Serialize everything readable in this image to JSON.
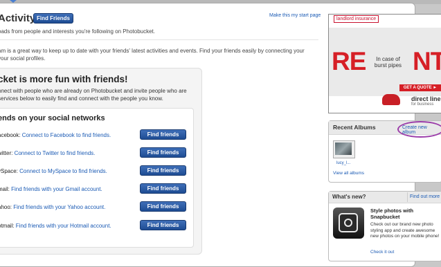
{
  "header": {
    "title": "Activity",
    "find_friends_label": "Find Friends",
    "make_start_page": "Make this my start page",
    "subtitle": "oads from people and interests you're following on Photobucket."
  },
  "intro": {
    "line1": "am is a great way to keep up to date with your friends' latest activities and events. Find your friends easily by connecting your",
    "line2": "your social profiles."
  },
  "panel": {
    "heading": "cket is more fun with friends!",
    "line1": "nnect with people who are already on Photobucket and invite people who are",
    "line2": "services below to easily find and connect with the people you know.",
    "networks_heading": "ends on your social networks",
    "rows": [
      {
        "name": "acebook:",
        "link": "Connect to Facebook to find friends.",
        "button": "Find friends"
      },
      {
        "name": "witter:",
        "link": "Connect to Twitter to find friends.",
        "button": "Find friends"
      },
      {
        "name": "ySpace:",
        "link": "Connect to MySpace to find friends.",
        "button": "Find friends"
      },
      {
        "name": "mail:",
        "link": "Find friends with your Gmail account.",
        "button": "Find friends"
      },
      {
        "name": "ahoo:",
        "link": "Find friends with your Yahoo account.",
        "button": "Find friends"
      },
      {
        "name": "otmail:",
        "link": "Find friends with your Hotmail account.",
        "button": "Find friends"
      }
    ]
  },
  "ad": {
    "brand": "landlord insurance",
    "big_left": "RE",
    "big_right": "NT",
    "tagline": "In case of burst pipes",
    "cta": "GET A QUOTE ►",
    "direct_line": "direct line",
    "for_business": "for business"
  },
  "albums": {
    "title": "Recent Albums",
    "create": "Create new album",
    "thumb_label": "lucy_l...",
    "view_all": "View all albums"
  },
  "whats_new": {
    "title": "What's new?",
    "find_out_more": "Find out more",
    "heading": "Style photos with Snapbucket",
    "body": "Check out our brand new photo styling app and create awesome new photos on your mobile phone!",
    "check_it_out": "Check it out"
  },
  "colors": {
    "link": "#1a5ab4",
    "button": "#1e4c93",
    "ad_red": "#d61f26",
    "annotation_circle": "#9b3ca9"
  }
}
